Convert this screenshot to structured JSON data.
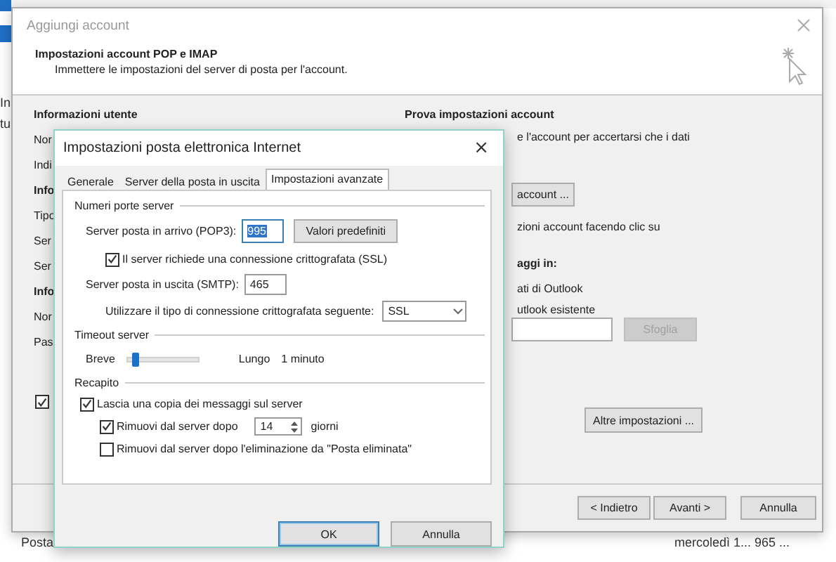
{
  "background_app": {
    "left_texts": [
      "In",
      "tu"
    ],
    "folder": "Posta",
    "message_info": "mercoledì 1... 965 ..."
  },
  "account_dialog": {
    "title": "Aggiungi account",
    "header": "Impostazioni account POP e IMAP",
    "subheader": "Immettere le impostazioni del server di posta per l'account.",
    "left_column": [
      {
        "text": "Informazioni utente",
        "kind": "heading"
      },
      {
        "text": "Nor",
        "kind": "label"
      },
      {
        "text": "Indi",
        "kind": "label"
      },
      {
        "text": "Info",
        "kind": "heading"
      },
      {
        "text": "Tipo",
        "kind": "label"
      },
      {
        "text": "Ser",
        "kind": "label"
      },
      {
        "text": "Ser",
        "kind": "label"
      },
      {
        "text": "Info",
        "kind": "heading"
      },
      {
        "text": "Nor",
        "kind": "label"
      },
      {
        "text": "Pas",
        "kind": "label"
      }
    ],
    "left_checkbox": {
      "checked": true
    },
    "right_column": {
      "heading": "Prova impostazioni account",
      "text_1": "e l'account per accertarsi che i dati",
      "test_button": "account ...",
      "text_2": "zioni account facendo clic su",
      "heading_2": "aggi in:",
      "option_1": "ati di Outlook",
      "option_2": "utlook esistente",
      "browse_button": {
        "label": "Sfoglia",
        "disabled": true
      },
      "more_settings_button": "Altre impostazioni ..."
    },
    "buttons": [
      {
        "label": "< Indietro"
      },
      {
        "label": "Avanti >"
      },
      {
        "label": "Annulla"
      }
    ]
  },
  "settings_dialog": {
    "title": "Impostazioni posta elettronica Internet",
    "close": "×",
    "tabs": [
      {
        "label": "Generale",
        "selected": false
      },
      {
        "label": "Server della posta in uscita",
        "selected": false
      },
      {
        "label": "Impostazioni avanzate",
        "selected": true
      }
    ],
    "ports": {
      "title": "Numeri porte server",
      "incoming_label": "Server posta in arrivo (POP3):",
      "incoming_value": "995",
      "defaults_button": "Valori predefiniti",
      "ssl": {
        "label": "Il server richiede una connessione crittografata (SSL)",
        "checked": true
      },
      "outgoing_label": "Server posta in uscita (SMTP):",
      "outgoing_value": "465",
      "encryption_label": "Utilizzare il tipo di connessione crittografata seguente:",
      "encryption_value": "SSL"
    },
    "timeout": {
      "title": "Timeout server",
      "min_label": "Breve",
      "max_label": "Lungo",
      "level": 0.1,
      "reading": "1 minuto"
    },
    "delivery": {
      "title": "Recapito",
      "keep_copy": {
        "label": "Lascia una copia dei messaggi sul server",
        "checked": true
      },
      "remove_after": {
        "label": "Rimuovi dal server dopo",
        "checked": true,
        "days": "14",
        "unit": "giorni"
      },
      "remove_on_delete": {
        "label": "Rimuovi dal server dopo l'eliminazione da \"Posta eliminata\"",
        "checked": false
      }
    },
    "buttons": [
      {
        "label": "OK",
        "kind": "default"
      },
      {
        "label": "Annulla",
        "kind": "normal"
      }
    ]
  }
}
